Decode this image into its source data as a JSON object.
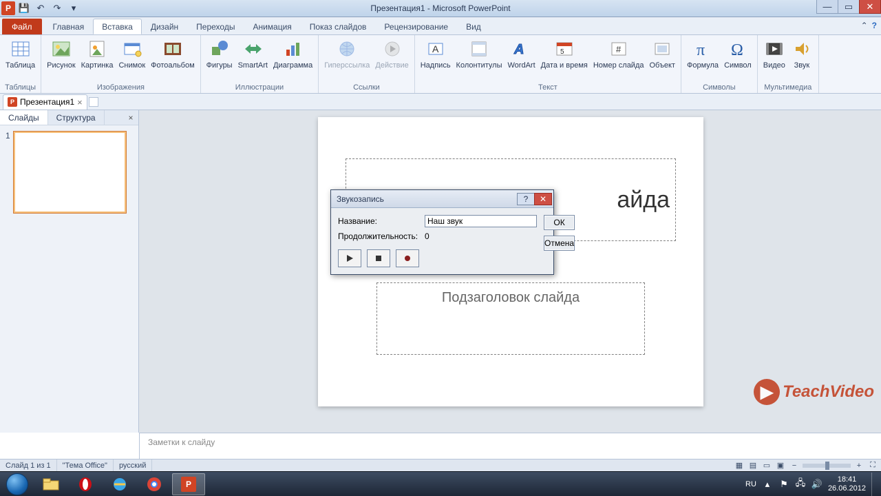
{
  "window": {
    "title": "Презентация1 - Microsoft PowerPoint"
  },
  "menu": {
    "file": "Файл",
    "tabs": [
      "Главная",
      "Вставка",
      "Дизайн",
      "Переходы",
      "Анимация",
      "Показ слайдов",
      "Рецензирование",
      "Вид"
    ],
    "active": 1
  },
  "ribbon": {
    "groups": [
      {
        "label": "Таблицы",
        "items": [
          {
            "k": "table",
            "lbl": "Таблица"
          }
        ]
      },
      {
        "label": "Изображения",
        "items": [
          {
            "k": "picture",
            "lbl": "Рисунок"
          },
          {
            "k": "clip",
            "lbl": "Картинка"
          },
          {
            "k": "screenshot",
            "lbl": "Снимок"
          },
          {
            "k": "album",
            "lbl": "Фотоальбом"
          }
        ]
      },
      {
        "label": "Иллюстрации",
        "items": [
          {
            "k": "shapes",
            "lbl": "Фигуры"
          },
          {
            "k": "smartart",
            "lbl": "SmartArt"
          },
          {
            "k": "chart",
            "lbl": "Диаграмма"
          }
        ]
      },
      {
        "label": "Ссылки",
        "items": [
          {
            "k": "hyperlink",
            "lbl": "Гиперссылка",
            "disabled": true
          },
          {
            "k": "action",
            "lbl": "Действие",
            "disabled": true
          }
        ]
      },
      {
        "label": "Текст",
        "items": [
          {
            "k": "textbox",
            "lbl": "Надпись"
          },
          {
            "k": "headerfooter",
            "lbl": "Колонтитулы"
          },
          {
            "k": "wordart",
            "lbl": "WordArt"
          },
          {
            "k": "datetime",
            "lbl": "Дата и время"
          },
          {
            "k": "slidenum",
            "lbl": "Номер слайда"
          },
          {
            "k": "object",
            "lbl": "Объект"
          }
        ]
      },
      {
        "label": "Символы",
        "items": [
          {
            "k": "equation",
            "lbl": "Формула"
          },
          {
            "k": "symbol",
            "lbl": "Символ"
          }
        ]
      },
      {
        "label": "Мультимедиа",
        "items": [
          {
            "k": "video",
            "lbl": "Видео"
          },
          {
            "k": "audio",
            "lbl": "Звук"
          }
        ]
      }
    ]
  },
  "doc_tabs": {
    "name": "Презентация1"
  },
  "sidebar": {
    "tabs": [
      "Слайды",
      "Структура"
    ],
    "active": 0,
    "slides": [
      {
        "num": "1"
      }
    ]
  },
  "slide": {
    "title_ph": "айда",
    "subtitle_ph": "Подзаголовок слайда"
  },
  "dialog": {
    "title": "Звукозапись",
    "name_label": "Название:",
    "name_value": "Наш звук",
    "duration_label": "Продолжительность:",
    "duration_value": "0",
    "ok": "ОК",
    "cancel": "Отмена"
  },
  "notes": {
    "placeholder": "Заметки к слайду"
  },
  "status": {
    "slide": "Слайд 1 из 1",
    "theme": "\"Тема Office\"",
    "lang": "русский"
  },
  "watermark": "TeachVideo",
  "tray": {
    "lang": "RU",
    "time": "18:41",
    "date": "26.06.2012"
  }
}
